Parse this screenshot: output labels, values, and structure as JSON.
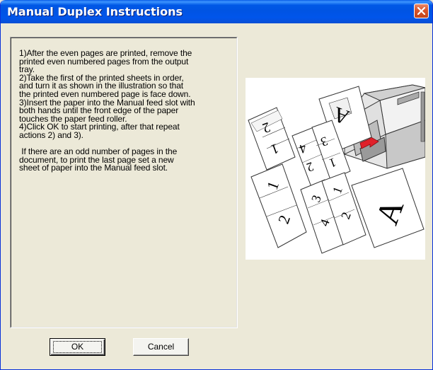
{
  "window": {
    "title": "Manual Duplex Instructions"
  },
  "instructions": {
    "step1_a": "1)After the even pages are printed, remove the",
    "step1_b": "printed even numbered pages from the output",
    "step1_c": "tray.",
    "step2_a": "2)Take the first of the printed sheets in order,",
    "step2_b": "and turn it as shown in the illustration so that",
    "step2_c": "the printed even numbered page is face down.",
    "step3_a": "3)Insert the paper into the Manual feed slot with",
    "step3_b": "both hands until the front edge of the paper",
    "step3_c": "touches the paper feed roller.",
    "step4_a": "4)Click OK to start printing, after that repeat",
    "step4_b": "actions 2) and 3).",
    "note_a": " If there are an odd number of pages in the",
    "note_b": "document, to print the last page set a new",
    "note_c": "sheet of paper into the Manual feed slot."
  },
  "illustration": {
    "labels": [
      "2",
      "1",
      "4",
      "2",
      "3",
      "1",
      "1",
      "2",
      "3",
      "4",
      "1",
      "2",
      "A",
      "A"
    ]
  },
  "buttons": {
    "ok_label": "OK",
    "cancel_label": "Cancel"
  },
  "colors": {
    "titlebar": "#0054e3",
    "close": "#d9532a",
    "dialog_bg": "#ece9d8",
    "arrow": "#e0202a"
  }
}
